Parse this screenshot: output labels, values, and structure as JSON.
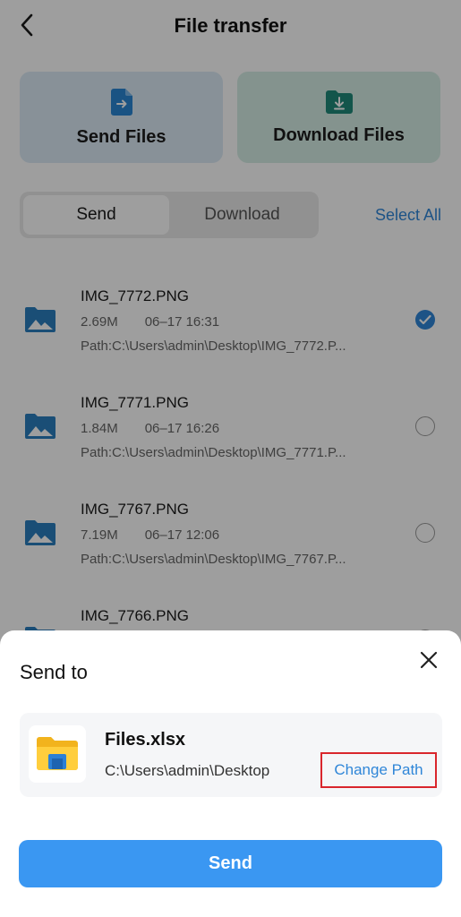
{
  "header": {
    "title": "File transfer"
  },
  "actions": {
    "send_label": "Send Files",
    "download_label": "Download Files"
  },
  "tabs": [
    {
      "label": "Send",
      "active": true
    },
    {
      "label": "Download",
      "active": false
    }
  ],
  "select_all": "Select All",
  "files": [
    {
      "name": "IMG_7772.PNG",
      "size": "2.69M",
      "time": "06–17 16:31",
      "path": "Path:C:\\Users\\admin\\Desktop\\IMG_7772.P...",
      "checked": true
    },
    {
      "name": "IMG_7771.PNG",
      "size": "1.84M",
      "time": "06–17 16:26",
      "path": "Path:C:\\Users\\admin\\Desktop\\IMG_7771.P...",
      "checked": false
    },
    {
      "name": "IMG_7767.PNG",
      "size": "7.19M",
      "time": "06–17 12:06",
      "path": "Path:C:\\Users\\admin\\Desktop\\IMG_7767.P...",
      "checked": false
    },
    {
      "name": "IMG_7766.PNG",
      "size": "",
      "time": "",
      "path": "",
      "checked": false
    }
  ],
  "sheet": {
    "title": "Send to",
    "target_name": "Files.xlsx",
    "target_path": "C:\\Users\\admin\\Desktop",
    "change_path_label": "Change Path",
    "send_label": "Send"
  },
  "colors": {
    "accent": "#3a97f2",
    "link": "#2f86d8",
    "highlight_border": "#d9262c",
    "send_card_bg": "#dbeaf6",
    "download_card_bg": "#d6ede6"
  },
  "icons": {
    "back": "chevron-left-icon",
    "send_files": "file-upload-icon",
    "download_files": "folder-download-icon",
    "file_thumb": "image-folder-icon",
    "check": "check-circle-icon",
    "close": "close-icon",
    "target_folder": "folder-icon"
  }
}
